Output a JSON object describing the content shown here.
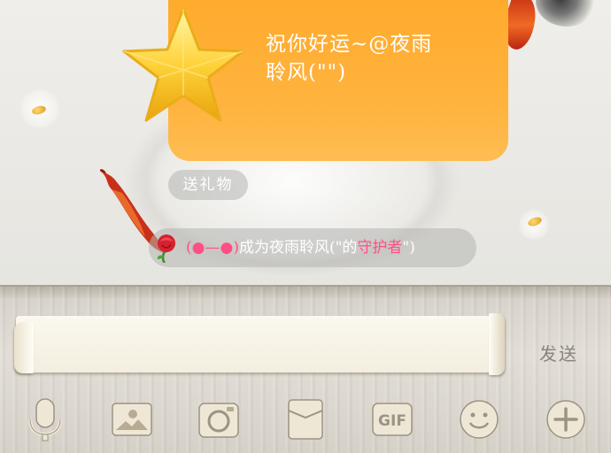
{
  "gift_message": {
    "line1": "祝你好运~@夜雨",
    "line2": "聆风(\"\")",
    "icon": "gold-star-icon"
  },
  "send_gift_label": "送礼物",
  "guardian_notice": {
    "open_paren": "(",
    "emoticon": "●—●",
    "close_paren": ")",
    "middle": "成为夜雨聆风(\"的",
    "title": "守护者",
    "tail": "\")",
    "icon": "rose-icon"
  },
  "composer": {
    "input_value": "",
    "input_placeholder": "",
    "send_label": "发送"
  },
  "toolbar_icons": [
    "microphone-icon",
    "photo-icon",
    "camera-icon",
    "envelope-icon",
    "gif-icon",
    "emoji-icon",
    "plus-icon"
  ],
  "gif_label": "GIF",
  "colors": {
    "bubble": "#ffad30",
    "highlight_pink": "#ff4f86",
    "pill_bg": "#b4b4b2"
  }
}
